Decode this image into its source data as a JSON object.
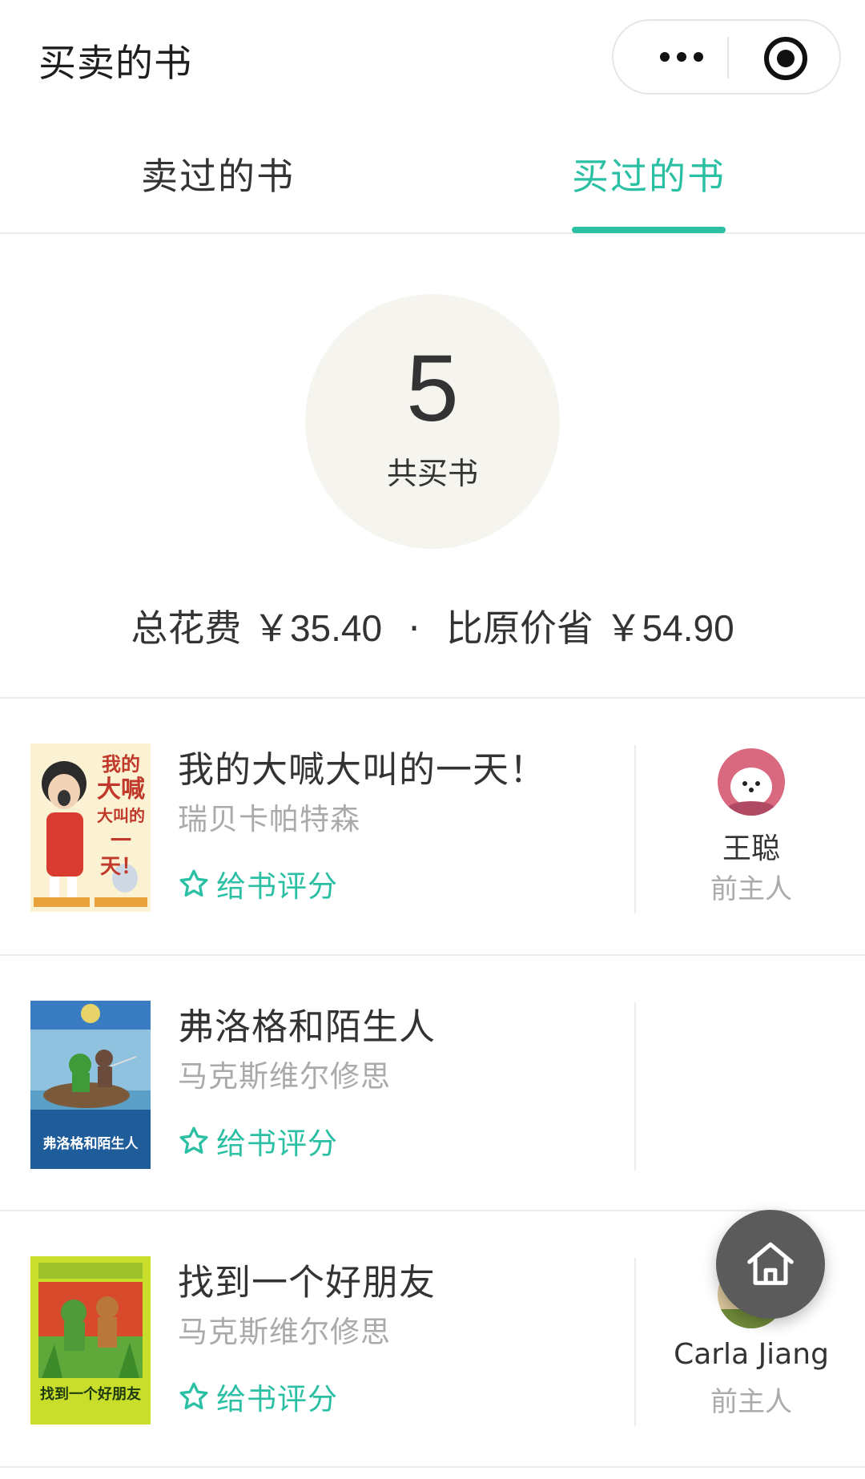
{
  "header": {
    "title": "买卖的书",
    "more_icon": "more-dots-icon",
    "close_icon": "target-close-icon"
  },
  "tabs": [
    {
      "label": "卖过的书",
      "active": false
    },
    {
      "label": "买过的书",
      "active": true
    }
  ],
  "summary": {
    "count": "5",
    "count_label": "共买书",
    "total_label": "总花费",
    "total_value": "￥35.40",
    "separator": "·",
    "saved_label": "比原价省",
    "saved_value": "￥54.90"
  },
  "books": [
    {
      "title": "我的大喊大叫的一天！",
      "author": "瑞贝卡帕特森",
      "rate_label": "给书评分",
      "owner_name": "王聪",
      "owner_role": "前主人",
      "cover_text": [
        "我的",
        "大喊",
        "大叫的",
        "一天！"
      ]
    },
    {
      "title": "弗洛格和陌生人",
      "author": "马克斯维尔修思",
      "rate_label": "给书评分",
      "owner_name": "",
      "owner_role": "",
      "cover_text": [
        "弗洛格和陌生人"
      ]
    },
    {
      "title": "找到一个好朋友",
      "author": "马克斯维尔修思",
      "rate_label": "给书评分",
      "owner_name": "Carla Jiang",
      "owner_role": "前主人",
      "cover_text": [
        "找到一个好朋友"
      ]
    }
  ],
  "colors": {
    "accent": "#2bbfa4",
    "summary_circle": "#f6f4ef",
    "fab": "#5b5b5b"
  },
  "fab": {
    "icon": "home-icon"
  }
}
